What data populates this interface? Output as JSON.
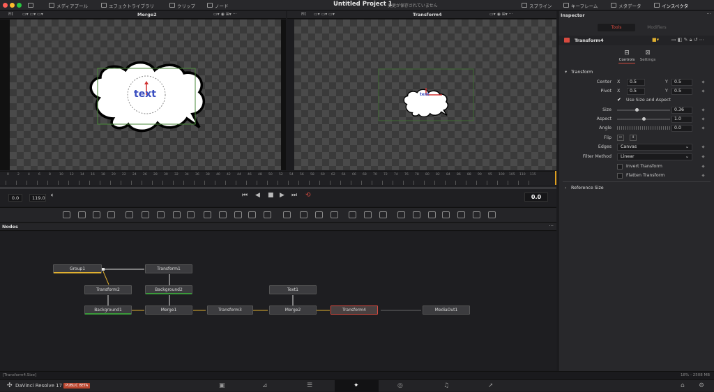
{
  "topbar": {
    "media_pool": "メディアプール",
    "effects_library": "エフェクトライブラリ",
    "clips": "クリップ",
    "nodes": "ノード",
    "project_title": "Untitled Project 1",
    "unsaved": "変更が保存されていません",
    "spline": "スプライン",
    "keyframes": "キーフレーム",
    "metadata": "メタデータ",
    "inspector": "インスペクタ"
  },
  "viewer_left": {
    "fit": "Fit",
    "title": "Merge2",
    "text": "text"
  },
  "viewer_right": {
    "fit": "Fit",
    "title": "Transform4",
    "text": "text"
  },
  "ruler": {
    "ticks": [
      "0",
      "2",
      "4",
      "6",
      "8",
      "10",
      "12",
      "14",
      "16",
      "18",
      "20",
      "22",
      "24",
      "26",
      "28",
      "30",
      "32",
      "34",
      "36",
      "38",
      "40",
      "42",
      "44",
      "46",
      "48",
      "50",
      "52",
      "54",
      "56",
      "58",
      "60",
      "62",
      "64",
      "66",
      "68",
      "70",
      "72",
      "74",
      "76",
      "78",
      "80",
      "82",
      "84",
      "86",
      "88",
      "90",
      "95",
      "100",
      "105",
      "110",
      "115"
    ]
  },
  "transport": {
    "start": "0.0",
    "end": "119.0",
    "current": "0.0"
  },
  "nodes_panel": {
    "title": "Nodes",
    "nodes": {
      "group1": "Group1",
      "transform1": "Transform1",
      "transform2": "Transform2",
      "background2": "Background2",
      "text1": "Text1",
      "background1": "Background1",
      "merge1": "Merge1",
      "transform3": "Transform3",
      "merge2": "Merge2",
      "transform4": "Transform4",
      "mediaout1": "MediaOut1"
    }
  },
  "status": {
    "left": "[Transform4.Size]",
    "right": "18% - 2508 MB"
  },
  "bottombar": {
    "app_name": "DaVinci Resolve 17",
    "badge": "PUBLIC BETA"
  },
  "inspector": {
    "title": "Inspector",
    "tabs": {
      "tools": "Tools",
      "modifiers": "Modifiers"
    },
    "node_name": "Transform4",
    "subtabs": {
      "controls": "Controls",
      "settings": "Settings"
    },
    "section_transform": "Transform",
    "center": {
      "label": "Center",
      "x_label": "X",
      "x": "0.5",
      "y_label": "Y",
      "y": "0.5"
    },
    "pivot": {
      "label": "Pivot",
      "x_label": "X",
      "x": "0.5",
      "y_label": "Y",
      "y": "0.5"
    },
    "use_size_aspect": "Use Size and Aspect",
    "size": {
      "label": "Size",
      "value": "0.36",
      "level": 0.36
    },
    "aspect": {
      "label": "Aspect",
      "value": "1.0"
    },
    "angle": {
      "label": "Angle",
      "value": "0.0"
    },
    "flip": {
      "label": "Flip"
    },
    "edges": {
      "label": "Edges",
      "value": "Canvas"
    },
    "filter_method": {
      "label": "Filter Method",
      "value": "Linear"
    },
    "invert_transform": "Invert Transform",
    "flatten_transform": "Flatten Transform",
    "section_reference": "Reference Size"
  },
  "colors": {
    "accent_red": "#d84a3f",
    "node_selected": "#d84a3f",
    "connection_yellow": "#e0b030"
  }
}
